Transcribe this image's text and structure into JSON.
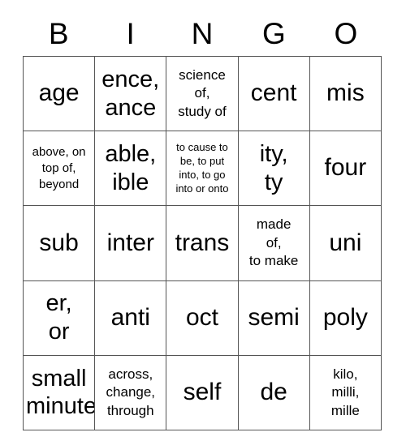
{
  "card": {
    "title_letters": [
      "B",
      "I",
      "N",
      "G",
      "O"
    ],
    "rows": [
      [
        {
          "text": "age",
          "size": "xl"
        },
        {
          "text": "ence,\nance",
          "size": "lg"
        },
        {
          "text": "science\nof,\nstudy of",
          "size": "md"
        },
        {
          "text": "cent",
          "size": "xl"
        },
        {
          "text": "mis",
          "size": "xl"
        }
      ],
      [
        {
          "text": "above, on\ntop of,\nbeyond",
          "size": "sm"
        },
        {
          "text": "able,\nible",
          "size": "lg"
        },
        {
          "text": "to cause to\nbe, to put\ninto, to go\ninto or onto",
          "size": "xs"
        },
        {
          "text": "ity,\nty",
          "size": "lg"
        },
        {
          "text": "four",
          "size": "xl"
        }
      ],
      [
        {
          "text": "sub",
          "size": "xl"
        },
        {
          "text": "inter",
          "size": "xl"
        },
        {
          "text": "trans",
          "size": "xl"
        },
        {
          "text": "made\nof,\nto make",
          "size": "md"
        },
        {
          "text": "uni",
          "size": "xl"
        }
      ],
      [
        {
          "text": "er,\nor",
          "size": "lg"
        },
        {
          "text": "anti",
          "size": "xl"
        },
        {
          "text": "oct",
          "size": "xl"
        },
        {
          "text": "semi",
          "size": "xl"
        },
        {
          "text": "poly",
          "size": "xl"
        }
      ],
      [
        {
          "text": "small\nminute",
          "size": "lg"
        },
        {
          "text": "across,\nchange,\nthrough",
          "size": "md"
        },
        {
          "text": "self",
          "size": "xl"
        },
        {
          "text": "de",
          "size": "xl"
        },
        {
          "text": "kilo,\nmilli,\nmille",
          "size": "md"
        }
      ]
    ],
    "colors": {
      "text": "#000000",
      "border": "#555555",
      "background": "#ffffff"
    }
  }
}
